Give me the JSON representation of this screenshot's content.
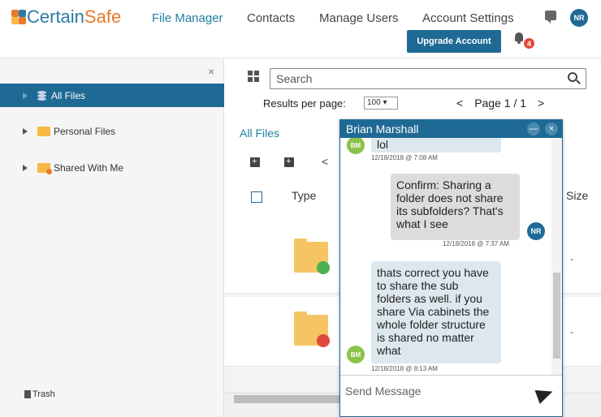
{
  "brand": {
    "name_a": "Certain",
    "name_b": "Safe"
  },
  "nav": {
    "file_manager": "File Manager",
    "contacts": "Contacts",
    "manage_users": "Manage Users",
    "account_settings": "Account Settings",
    "user_initials": "NR",
    "upgrade": "Upgrade Account",
    "notifications_count": "4"
  },
  "sidebar": {
    "close": "×",
    "items": [
      {
        "label": "All Files"
      },
      {
        "label": "Personal Files"
      },
      {
        "label": "Shared With Me"
      }
    ],
    "trash": "Trash"
  },
  "main": {
    "search_placeholder": "Search",
    "results_label": "Results per page:",
    "results_value": "100",
    "page_label": "Page 1 / 1",
    "prev": "<",
    "next": ">",
    "breadcrumb": "All Files",
    "col_type": "Type",
    "col_size": "Size",
    "rows": [
      {
        "size": "-"
      },
      {
        "size": "-"
      }
    ]
  },
  "chat": {
    "title": "Brian Marshall",
    "minimize": "—",
    "close": "×",
    "messages": [
      {
        "from": "BM",
        "text": "lol",
        "time": "12/18/2018 @ 7:08 AM"
      },
      {
        "from": "NR",
        "text": "Confirm: Sharing a folder does not share its subfolders? That's what I see",
        "time": "12/18/2018 @ 7:37 AM"
      },
      {
        "from": "BM",
        "text": "thats correct you have to share the sub folders as well. if you share Via cabinets the whole folder structure is shared no matter what",
        "time": "12/18/2018 @ 8:13 AM"
      }
    ],
    "input_placeholder": "Send Message"
  },
  "colors": {
    "primary": "#1f6a95",
    "link": "#1f7fa0",
    "accent": "#e8792b",
    "folder": "#f5c564",
    "badge": "#e0493d"
  }
}
